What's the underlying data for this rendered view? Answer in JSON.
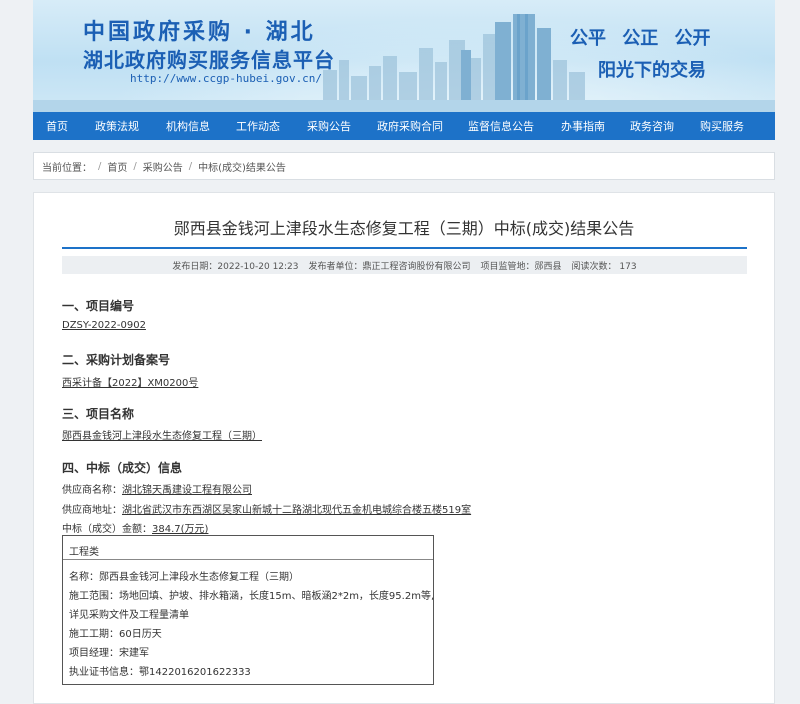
{
  "header": {
    "title_line1": "中国政府采购 · 湖北",
    "title_line2": "湖北政府购买服务信息平台",
    "url": "http://www.ccgp-hubei.gov.cn/",
    "slogan_line1": "公平 公正 公开",
    "slogan_line2": "阳光下的交易"
  },
  "nav": {
    "items": [
      "首页",
      "政策法规",
      "机构信息",
      "工作动态",
      "采购公告",
      "政府采购合同",
      "监督信息公告",
      "办事指南",
      "政务咨询",
      "购买服务"
    ]
  },
  "breadcrumb": {
    "label": "当前位置：",
    "items": [
      "首页",
      "采购公告",
      "中标(成交)结果公告"
    ]
  },
  "article": {
    "title": "郧西县金钱河上津段水生态修复工程（三期）中标(成交)结果公告",
    "meta": {
      "publish_date": "发布日期：2022-10-20 12:23",
      "publisher": "发布者单位：鼎正工程咨询股份有限公司",
      "region": "项目监管地：郧西县",
      "views": "阅读次数： 173"
    },
    "sections": [
      {
        "heading": "一、项目编号",
        "value": "DZSY-2022-0902"
      },
      {
        "heading": "二、采购计划备案号",
        "value": "西采计备【2022】XM0200号"
      },
      {
        "heading": "三、项目名称",
        "value": "郧西县金钱河上津段水生态修复工程（三期）"
      },
      {
        "heading": "四、中标（成交）信息"
      }
    ],
    "supplier_name_label": "供应商名称：",
    "supplier_name": "湖北锦天禹建设工程有限公司",
    "supplier_addr_label": "供应商地址：",
    "supplier_addr": "湖北省武汉市东西湖区吴家山新城十二路湖北现代五金机电城综合楼五楼519室",
    "amount_label": "中标（成交）金额：",
    "amount": "384.7(万元)",
    "box": {
      "category": "工程类",
      "name": "名称：郧西县金钱河上津段水生态修复工程（三期）",
      "scope1": "施工范围：场地回填、护坡、排水箱涵，长度15m、暗板涵2*2m，长度95.2m等,",
      "scope2": "详见采购文件及工程量清单",
      "period": "施工工期：60日历天",
      "manager": "项目经理：宋建军",
      "cert": "执业证书信息：鄂1422016201622333"
    }
  }
}
